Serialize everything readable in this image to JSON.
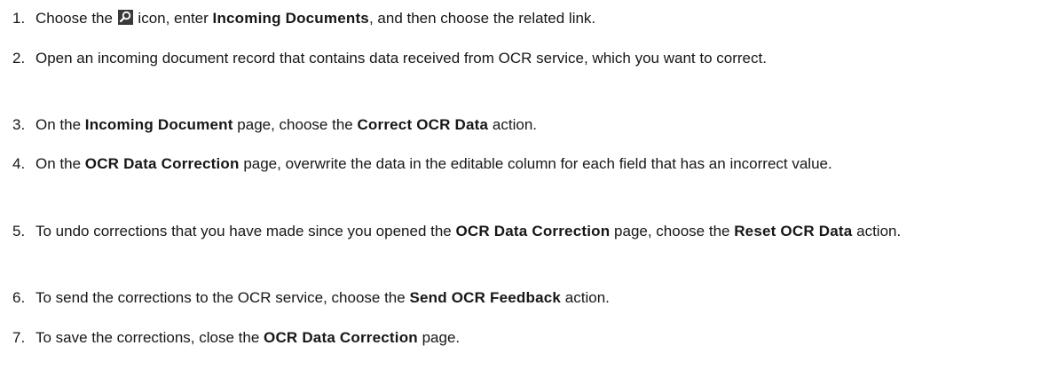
{
  "steps": [
    {
      "number": "1.",
      "parts": [
        {
          "t": "text",
          "v": "Choose the "
        },
        {
          "t": "icon",
          "name": "search-icon"
        },
        {
          "t": "text",
          "v": " icon, enter "
        },
        {
          "t": "bold",
          "v": "Incoming Documents"
        },
        {
          "t": "text",
          "v": ", and then choose the related link."
        }
      ]
    },
    {
      "number": "2.",
      "parts": [
        {
          "t": "text",
          "v": "Open an incoming document record that contains data received from OCR service, which you want to correct."
        }
      ]
    },
    {
      "number": "3.",
      "parts": [
        {
          "t": "text",
          "v": "On the "
        },
        {
          "t": "bold",
          "v": "Incoming Document"
        },
        {
          "t": "text",
          "v": " page, choose the "
        },
        {
          "t": "bold",
          "v": "Correct OCR Data"
        },
        {
          "t": "text",
          "v": " action."
        }
      ]
    },
    {
      "number": "4.",
      "parts": [
        {
          "t": "text",
          "v": "On the "
        },
        {
          "t": "bold",
          "v": "OCR Data Correction"
        },
        {
          "t": "text",
          "v": " page, overwrite the data in the editable column for each field that has an incorrect value."
        }
      ]
    },
    {
      "number": "5.",
      "parts": [
        {
          "t": "text",
          "v": "To undo corrections that you have made since you opened the "
        },
        {
          "t": "bold",
          "v": "OCR Data Correction"
        },
        {
          "t": "text",
          "v": " page, choose the "
        },
        {
          "t": "bold",
          "v": "Reset OCR Data"
        },
        {
          "t": "text",
          "v": " action."
        }
      ]
    },
    {
      "number": "6.",
      "parts": [
        {
          "t": "text",
          "v": "To send the corrections to the OCR service, choose the "
        },
        {
          "t": "bold",
          "v": "Send OCR Feedback"
        },
        {
          "t": "text",
          "v": " action."
        }
      ]
    },
    {
      "number": "7.",
      "parts": [
        {
          "t": "text",
          "v": "To save the corrections, close the "
        },
        {
          "t": "bold",
          "v": "OCR Data Correction"
        },
        {
          "t": "text",
          "v": " page."
        }
      ]
    }
  ]
}
